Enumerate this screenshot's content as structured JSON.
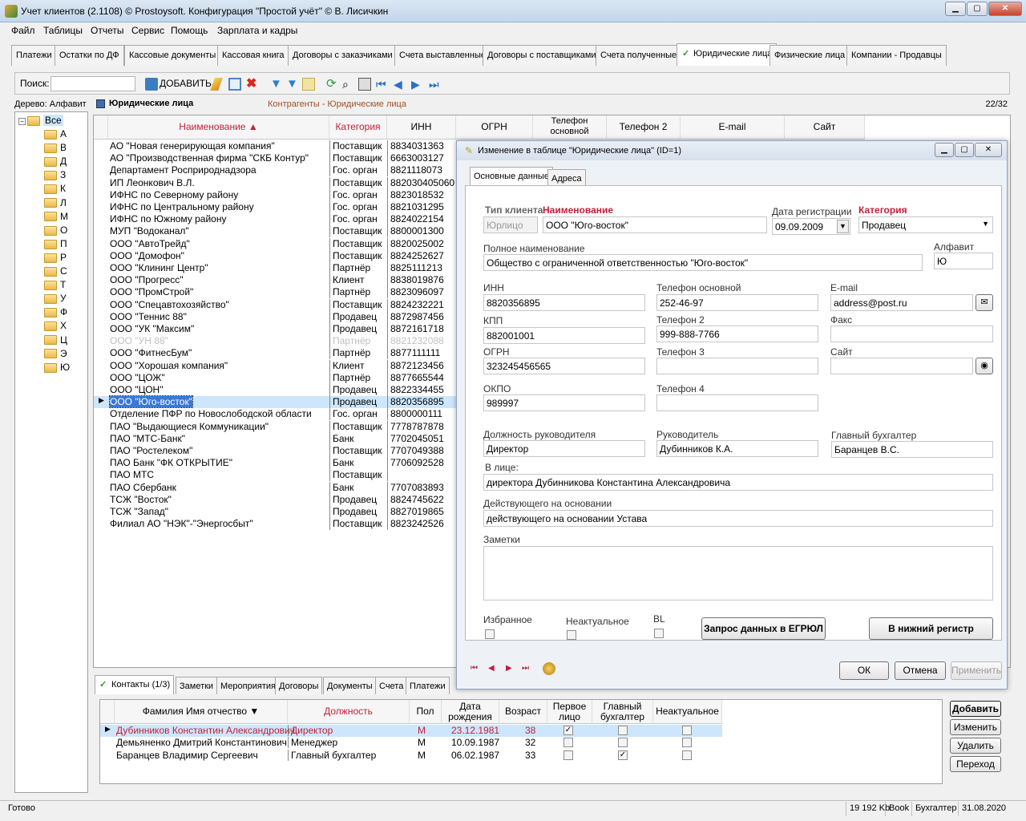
{
  "window": {
    "title": "Учет клиентов (2.1108) © Prostoysoft. Конфигурация \"Простой учёт\" © В. Лисичкин"
  },
  "menu": [
    "Файл",
    "Таблицы",
    "Отчеты",
    "Сервис",
    "Помощь",
    "Зарплата и кадры"
  ],
  "tabs": [
    "Платежи",
    "Остатки по ДФ",
    "Кассовые документы",
    "Кассовая книга",
    "Договоры с заказчиками",
    "Счета выставленные",
    "Договоры с поставщиками",
    "Счета полученные",
    "Юридические лица",
    "Физические лица",
    "Компании - Продавцы"
  ],
  "toolbar": {
    "search_label": "Поиск:",
    "add_label": "ДОБАВИТЬ"
  },
  "tree": {
    "header": "Дерево: Алфавит",
    "root": "Все",
    "items": [
      "А",
      "В",
      "Д",
      "З",
      "К",
      "Л",
      "М",
      "О",
      "П",
      "Р",
      "С",
      "Т",
      "У",
      "Ф",
      "Х",
      "Ц",
      "Э",
      "Ю"
    ]
  },
  "grid": {
    "title": "Юридические лица",
    "subtitle": "Контрагенты - Юридические лица",
    "counter": "22/32",
    "columns": [
      "Наименование",
      "Категория",
      "ИНН",
      "ОГРН",
      "Телефон основной",
      "Телефон 2",
      "E-mail",
      "Сайт"
    ],
    "rows": [
      [
        "АО \"Новая генерирующая компания\"",
        "Поставщик",
        "8834031363"
      ],
      [
        "АО \"Производственная фирма \"СКБ Контур\"",
        "Поставщик",
        "6663003127"
      ],
      [
        "Департамент Росприроднадзора",
        "Гос. орган",
        "8821118073"
      ],
      [
        "ИП Леонкович В.Л.",
        "Поставщик",
        "882030405060"
      ],
      [
        "ИФНС по Северному району",
        "Гос. орган",
        "8823018532"
      ],
      [
        "ИФНС по Центральному району",
        "Гос. орган",
        "8821031295"
      ],
      [
        "ИФНС по Южному району",
        "Гос. орган",
        "8824022154"
      ],
      [
        "МУП \"Водоканал\"",
        "Поставщик",
        "8800001300"
      ],
      [
        "ООО \"АвтоТрейд\"",
        "Поставщик",
        "8820025002"
      ],
      [
        "ООО \"Домофон\"",
        "Поставщик",
        "8824252627"
      ],
      [
        "ООО \"Клининг Центр\"",
        "Партнёр",
        "8825111213"
      ],
      [
        "ООО \"Прогресс\"",
        "Клиент",
        "8838019876"
      ],
      [
        "ООО \"ПромСтрой\"",
        "Партнёр",
        "8823096097"
      ],
      [
        "ООО \"Спецавтохозяйство\"",
        "Поставщик",
        "8824232221"
      ],
      [
        "ООО \"Теннис 88\"",
        "Продавец",
        "8872987456"
      ],
      [
        "ООО \"УК \"Максим\"",
        "Продавец",
        "8872161718"
      ],
      [
        "ООО \"УН 88\"",
        "Партнёр",
        "8821232088"
      ],
      [
        "ООО \"ФитнесБум\"",
        "Партнёр",
        "8877111111"
      ],
      [
        "ООО \"Хорошая компания\"",
        "Клиент",
        "8872123456"
      ],
      [
        "ООО \"ЦОЖ\"",
        "Партнёр",
        "8877665544"
      ],
      [
        "ООО \"ЦОН\"",
        "Продавец",
        "8822334455"
      ],
      [
        "ООО \"Юго-восток\"",
        "Продавец",
        "8820356895"
      ],
      [
        "Отделение ПФР по Новослободской области",
        "Гос. орган",
        "8800000111"
      ],
      [
        "ПАО \"Выдающиеся Коммуникации\"",
        "Поставщик",
        "7778787878"
      ],
      [
        "ПАО \"МТС-Банк\"",
        "Банк",
        "7702045051"
      ],
      [
        "ПАО \"Ростелеком\"",
        "Поставщик",
        "7707049388"
      ],
      [
        "ПАО Банк \"ФК ОТКРЫТИЕ\"",
        "Банк",
        "7706092528"
      ],
      [
        "ПАО МТС",
        "Поставщик",
        ""
      ],
      [
        "ПАО Сбербанк",
        "Банк",
        "7707083893"
      ],
      [
        "ТСЖ \"Восток\"",
        "Продавец",
        "8824745622"
      ],
      [
        "ТСЖ \"Запад\"",
        "Продавец",
        "8827019865"
      ],
      [
        "Филиал АО \"НЭК\"-\"Энергосбыт\"",
        "Поставщик",
        "8823242526"
      ]
    ]
  },
  "dialog": {
    "title": "Изменение в таблице \"Юридические лица\" (ID=1)",
    "tabs": [
      "Основные данные",
      "Адреса"
    ],
    "labels": {
      "client_type": "Тип клиента",
      "name": "Наименование",
      "reg_date": "Дата регистрации",
      "category": "Категория",
      "full_name": "Полное наименование",
      "alphabet": "Алфавит",
      "inn": "ИНН",
      "phone_main": "Телефон основной",
      "email": "E-mail",
      "kpp": "КПП",
      "phone2": "Телефон 2",
      "fax": "Факс",
      "ogrn": "ОГРН",
      "phone3": "Телефон 3",
      "site": "Сайт",
      "okpo": "ОКПО",
      "phone4": "Телефон 4",
      "head_position": "Должность руководителя",
      "head": "Руководитель",
      "accountant": "Главный бухгалтер",
      "in_person": "В лице:",
      "acting_basis": "Действующего на основании",
      "notes": "Заметки",
      "favorite": "Избранное",
      "inactual": "Неактуальное",
      "bl": "BL"
    },
    "values": {
      "client_type": "Юрлицо",
      "name": "ООО \"Юго-восток\"",
      "reg_date": "09.09.2009",
      "category": "Продавец",
      "full_name": "Общество с ограниченной ответственностью \"Юго-восток\"",
      "alphabet": "Ю",
      "inn": "8820356895",
      "phone_main": "252-46-97",
      "email": "address@post.ru",
      "kpp": "882001001",
      "phone2": "999-888-7766",
      "ogrn": "323245456565",
      "okpo": "989997",
      "head_position": "Директор",
      "head": "Дубинников К.А.",
      "accountant": "Баранцев В.С.",
      "in_person": "директора Дубинникова Константина Александровича",
      "acting_basis": "действующего на основании Устава"
    },
    "buttons": {
      "egrul": "Запрос данных в ЕГРЮЛ",
      "lowercase": "В нижний регистр",
      "ok": "ОК",
      "cancel": "Отмена",
      "apply": "Применить"
    }
  },
  "contacts": {
    "tabs": [
      "Контакты (1/3)",
      "Заметки",
      "Мероприятия",
      "Договоры",
      "Документы",
      "Счета",
      "Платежи"
    ],
    "columns": [
      "Фамилия Имя отчество",
      "Должность",
      "Пол",
      "Дата рождения",
      "Возраст",
      "Первое лицо",
      "Главный бухгалтер",
      "Неактуальное"
    ],
    "rows": [
      {
        "name": "Дубинников Константин Александрович",
        "position": "Директор",
        "sex": "М",
        "birth": "23.12.1981",
        "age": "38",
        "first": true,
        "acc": false,
        "inact": false
      },
      {
        "name": "Демьяненко Дмитрий Константинович",
        "position": "Менеджер",
        "sex": "М",
        "birth": "10.09.1987",
        "age": "32",
        "first": false,
        "acc": false,
        "inact": false
      },
      {
        "name": "Баранцев Владимир Сергеевич",
        "position": "Главный бухгалтер",
        "sex": "М",
        "birth": "06.02.1987",
        "age": "33",
        "first": false,
        "acc": true,
        "inact": false
      }
    ],
    "buttons": [
      "Добавить",
      "Изменить",
      "Удалить",
      "Переход"
    ]
  },
  "status": {
    "left": "Готово",
    "mem": "19 192 Kb",
    "book": "Book",
    "user": "Бухгалтер",
    "date": "31.08.2020"
  }
}
